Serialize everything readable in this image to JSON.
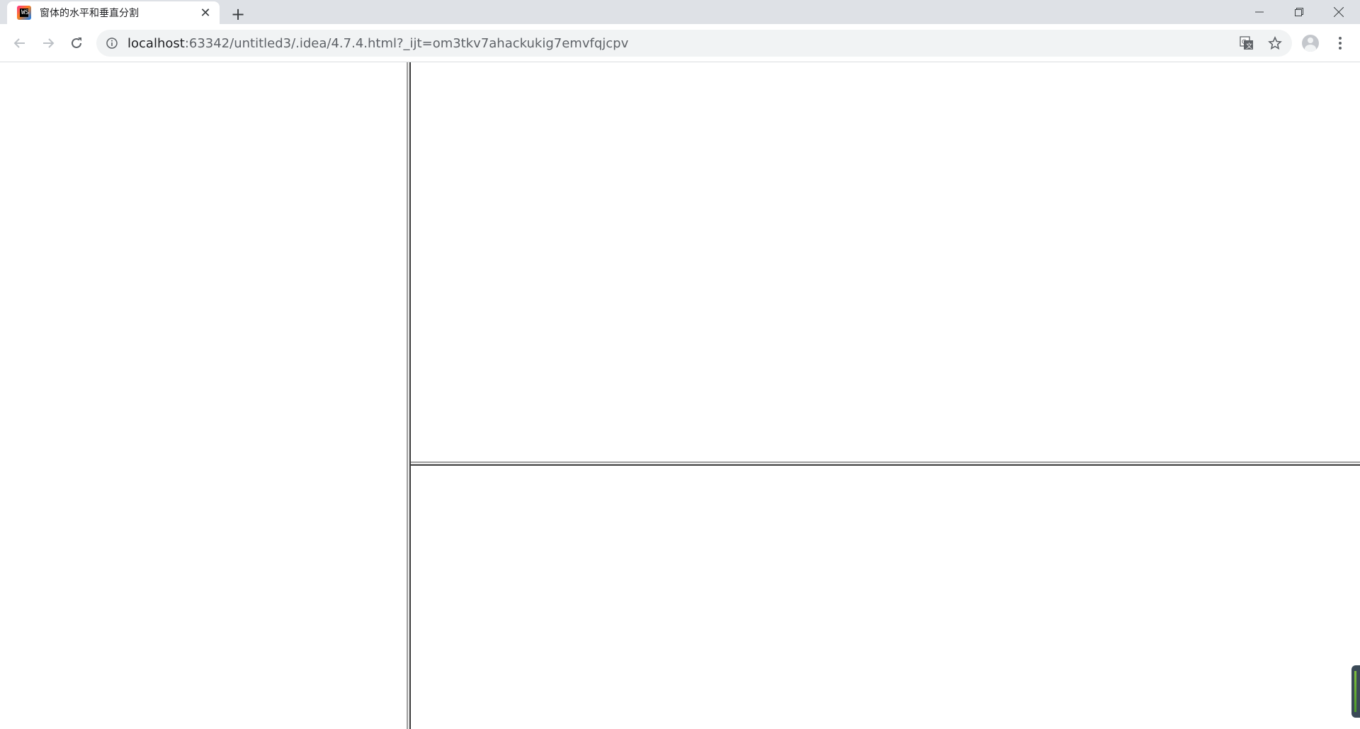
{
  "browser": {
    "tab": {
      "title": "窗体的水平和垂直分割",
      "favicon_text": "WS"
    },
    "address": {
      "host": "localhost",
      "rest": ":63342/untitled3/.idea/4.7.4.html?_ijt=om3tkv7ahackukig7emvfqjcpv"
    },
    "icons": {
      "back": "arrow-left-icon",
      "forward": "arrow-right-icon",
      "reload": "reload-icon",
      "info": "info-icon",
      "translate": "translate-icon",
      "bookmark": "star-icon",
      "profile": "avatar-icon",
      "menu": "kebab-menu-icon",
      "new_tab": "plus-icon",
      "close_tab": "close-icon"
    }
  },
  "frames": {
    "layout": "left frame | right column split into top and bottom frames"
  },
  "colors": {
    "tabstrip": "#dee1e6",
    "omnibox": "#f1f3f4",
    "splitter": "#a0a0a0"
  }
}
